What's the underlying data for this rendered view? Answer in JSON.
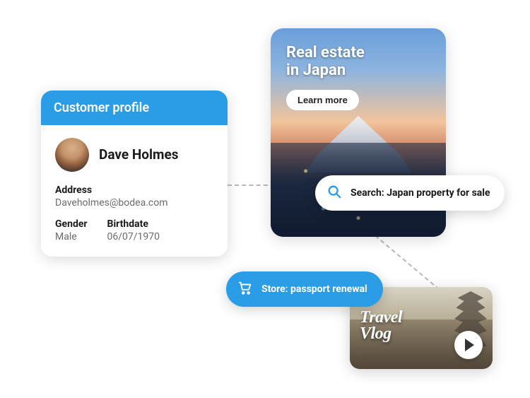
{
  "profile": {
    "header": "Customer profile",
    "name": "Dave Holmes",
    "address_label": "Address",
    "address_value": "Daveholmes@bodea.com",
    "gender_label": "Gender",
    "gender_value": "Male",
    "birthdate_label": "Birthdate",
    "birthdate_value": "06/07/1970"
  },
  "realestate": {
    "title_line1": "Real estate",
    "title_line2": "in Japan",
    "cta": "Learn more"
  },
  "search": {
    "text": "Search: Japan property for sale"
  },
  "store": {
    "text": "Store: passport renewal"
  },
  "vlog": {
    "title_line1": "Travel",
    "title_line2": "Vlog"
  },
  "colors": {
    "brand_blue": "#2b9ce6"
  }
}
